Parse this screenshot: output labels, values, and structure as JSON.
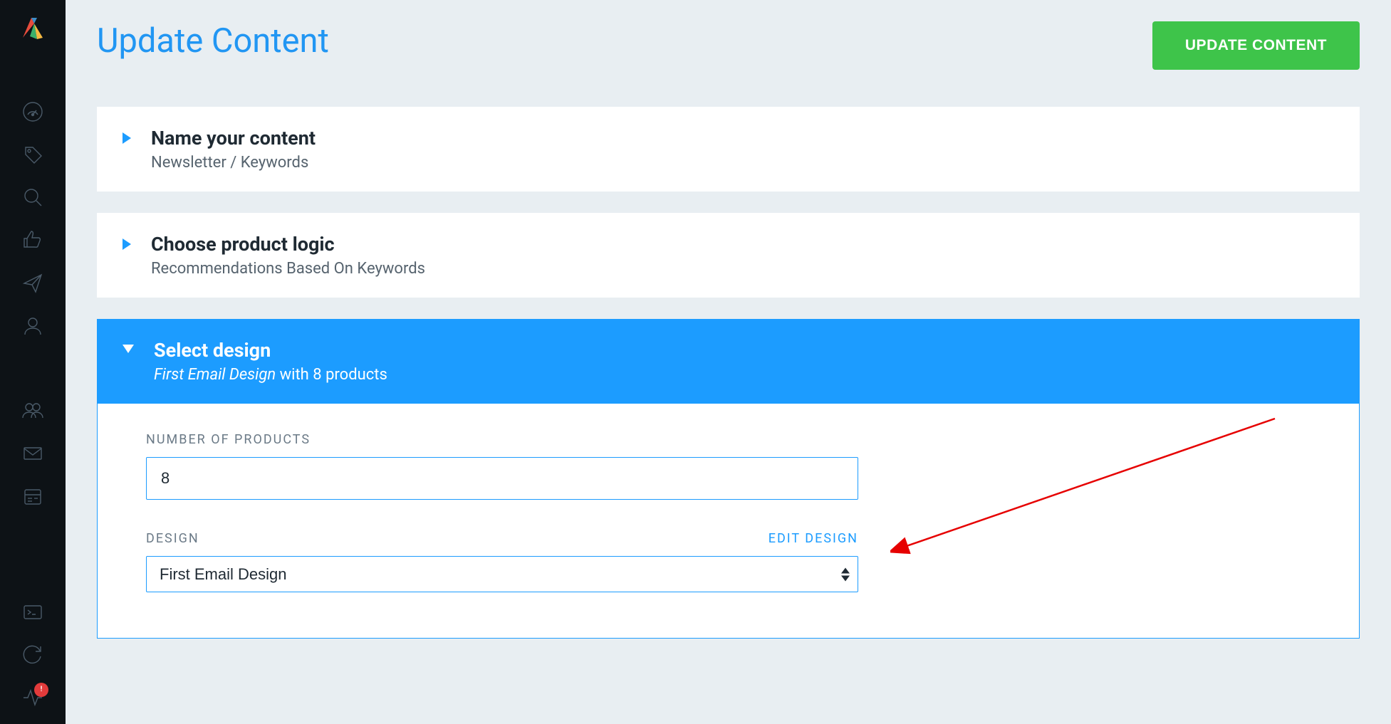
{
  "page_title": "Update Content",
  "button_update": "UPDATE CONTENT",
  "sections": {
    "name": {
      "title": "Name your content",
      "subtitle": "Newsletter / Keywords"
    },
    "logic": {
      "title": "Choose product logic",
      "subtitle": "Recommendations Based On Keywords"
    },
    "design": {
      "title": "Select design",
      "subtitle_design_name": "First Email Design",
      "subtitle_rest": " with 8 products",
      "form": {
        "num_products_label": "NUMBER OF PRODUCTS",
        "num_products_value": "8",
        "design_label": "DESIGN",
        "edit_design_link": "EDIT DESIGN",
        "design_selected": "First Email Design"
      }
    }
  },
  "sidebar": {
    "icons": {
      "dashboard": "dashboard-icon",
      "tag": "tag-icon",
      "search": "search-icon",
      "thumbsup": "thumbsup-icon",
      "send": "send-icon",
      "user": "user-icon",
      "users": "users-icon",
      "envelope": "envelope-icon",
      "template": "template-icon",
      "terminal": "terminal-icon",
      "refresh": "refresh-icon",
      "activity": "activity-icon"
    },
    "badge": "!"
  }
}
